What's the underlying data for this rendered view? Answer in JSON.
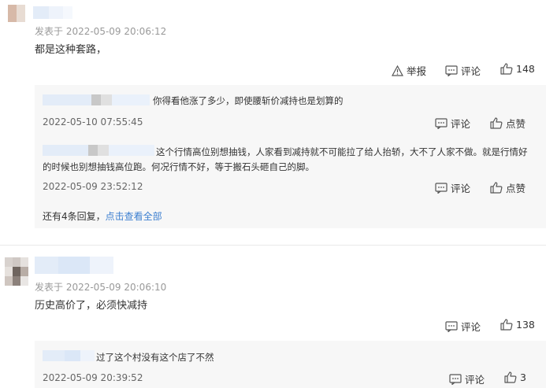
{
  "comments": [
    {
      "date": "发表于 2022-05-09 20:06:12",
      "text": "都是这种套路，",
      "report_label": "举报",
      "comment_label": "评论",
      "like_count": "148",
      "replies": [
        {
          "text": "你得看他涨了多少，即使腰斩价减持也是划算的",
          "date": "2022-05-10 07:55:45",
          "comment_label": "评论",
          "like_label": "点赞"
        },
        {
          "text_line1": "这个行情高位别想抽钱，人家看到减持就不可能拉了给人抬轿，大不了人家不做。就是行情好",
          "text_line2": "的时候也别想抽钱高位跑。何况行情不好，等于搬石头砸自己的脚。",
          "date": "2022-05-09 23:52:12",
          "comment_label": "评论",
          "like_label": "点赞"
        }
      ],
      "more_replies": "还有4条回复，",
      "view_all": "点击查看全部"
    },
    {
      "date": "发表于 2022-05-09 20:06:10",
      "text": "历史高价了，必须快减持",
      "comment_label": "评论",
      "like_count": "138",
      "replies": [
        {
          "text": "过了这个村没有这个店了不然",
          "date": "2022-05-09 20:39:52",
          "comment_label": "评论",
          "like_count": "3"
        }
      ]
    }
  ]
}
